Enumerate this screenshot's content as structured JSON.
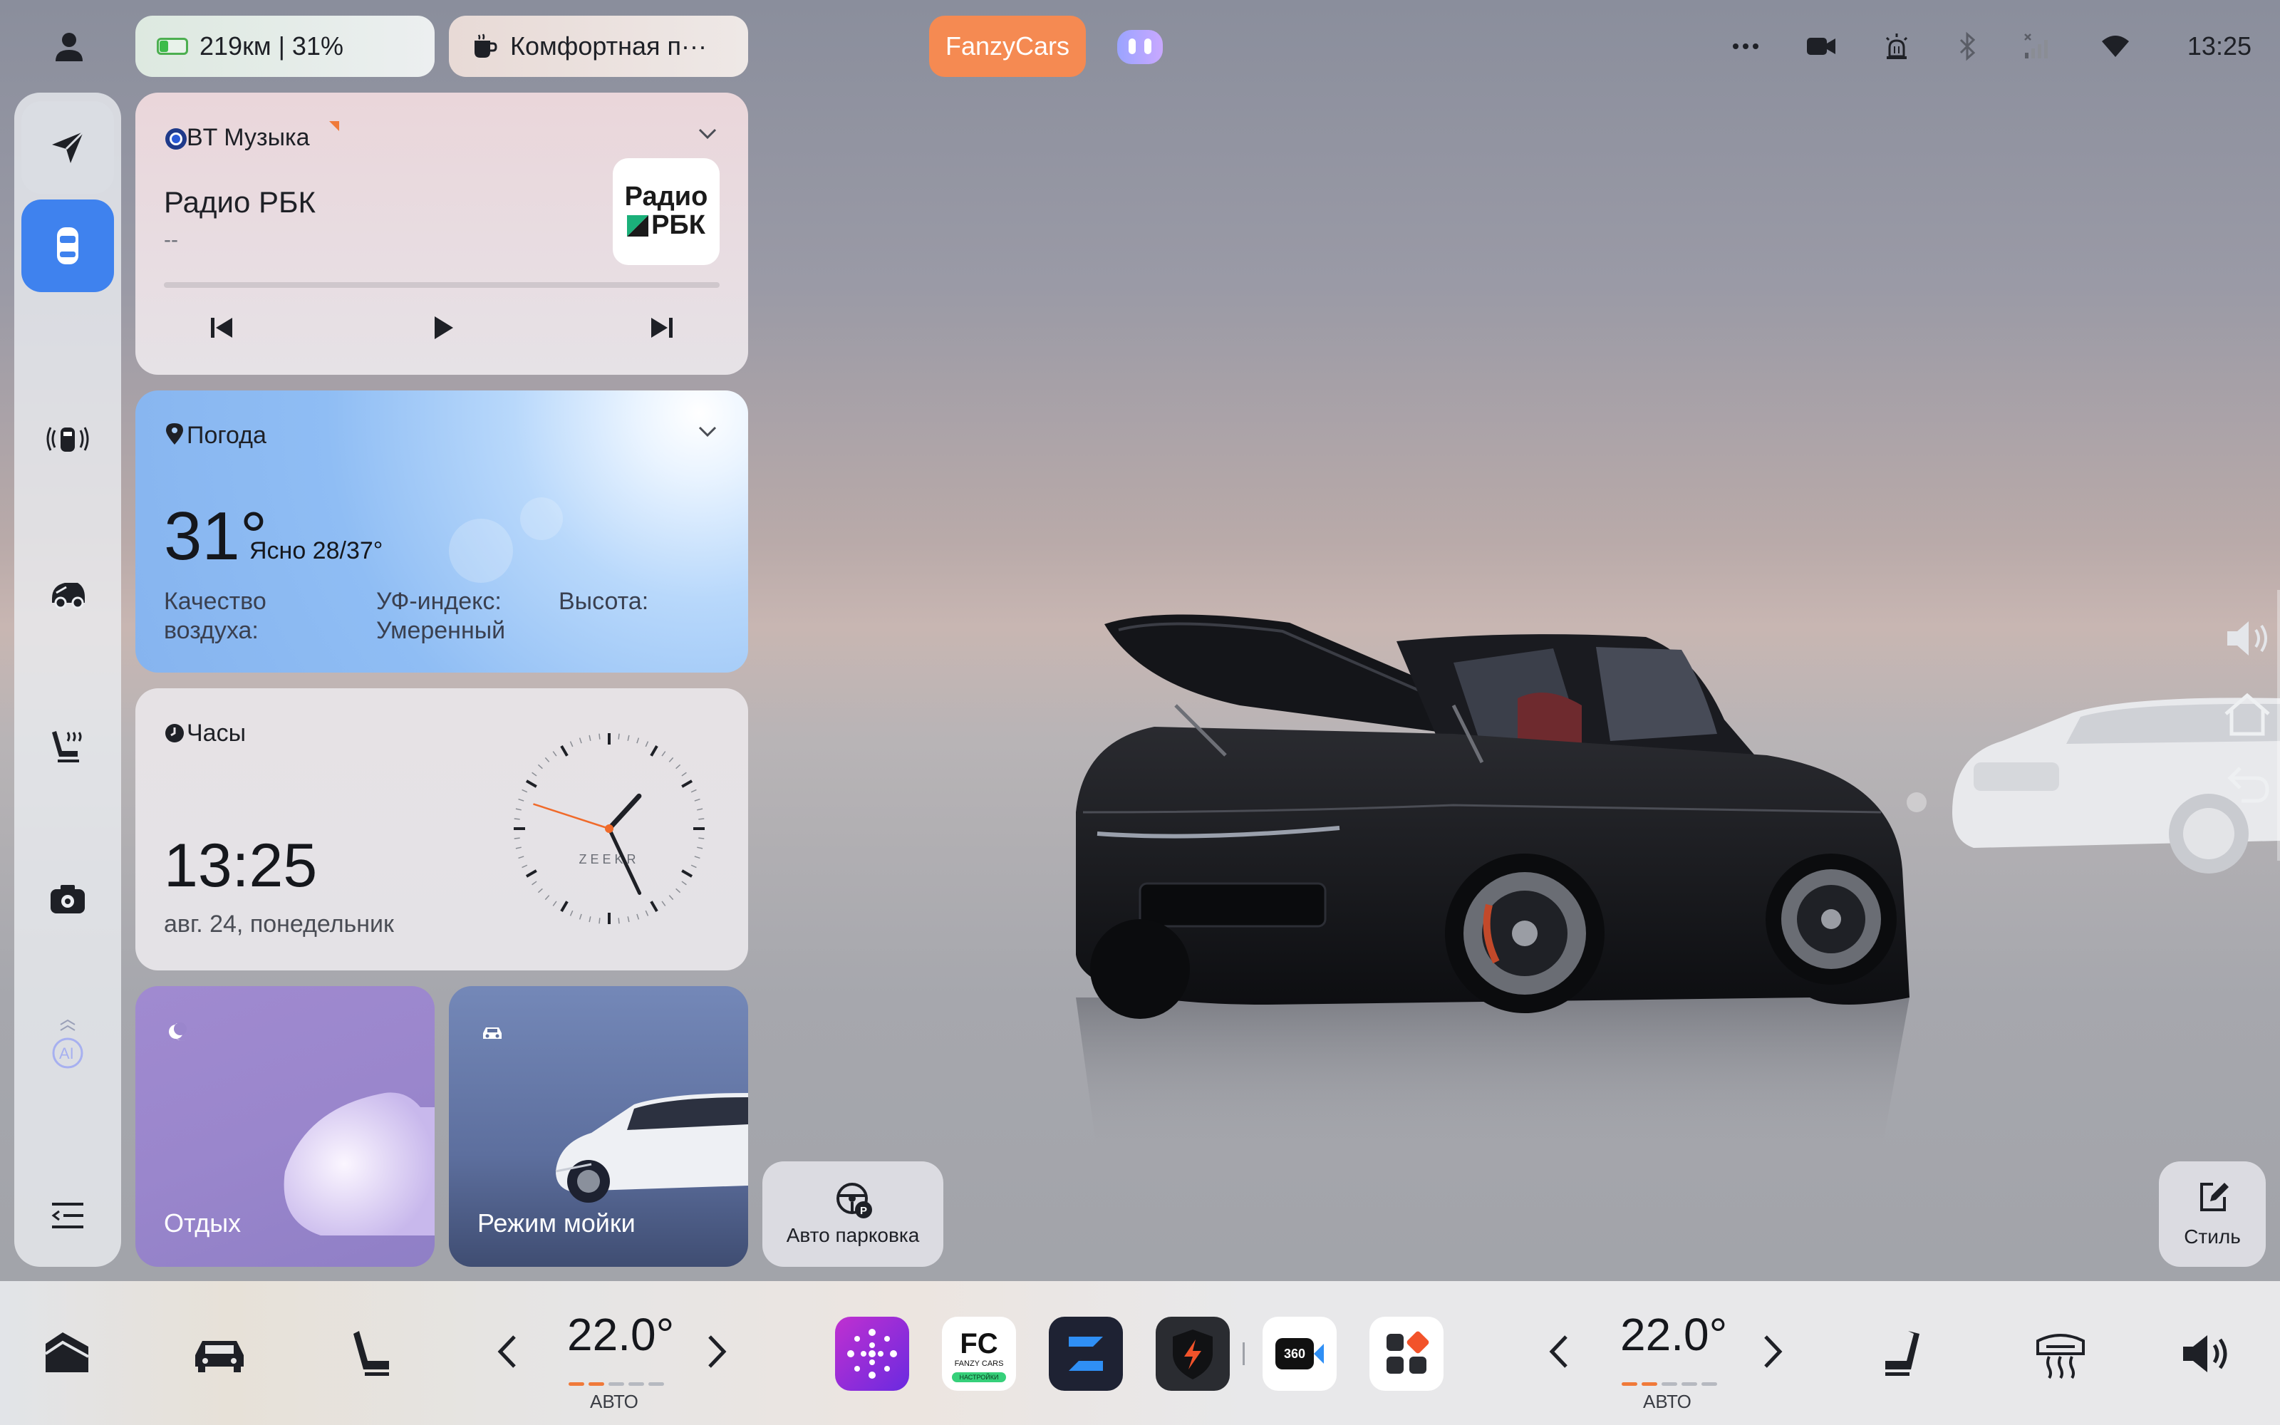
{
  "status_bar": {
    "range": "219км | 31%",
    "drive_mode": "Комфортная п···",
    "brand": "FanzyCars",
    "time": "13:25"
  },
  "music": {
    "source": "BT Музыка",
    "station": "Радио РБК",
    "subtitle": "--",
    "art_line1": "Радио",
    "art_line2": "РБК"
  },
  "weather": {
    "title": "Погода",
    "temperature": "31°",
    "description": "Ясно 28/37°",
    "air_quality": "Качество воздуха:",
    "uv": "УФ-индекс: Умеренный",
    "altitude": "Высота:"
  },
  "clock": {
    "title": "Часы",
    "time": "13:25",
    "date": "авг. 24, понедельник",
    "brand": "ZEEKR",
    "hour": 1,
    "minute": 25,
    "second": 48
  },
  "scenes": {
    "rest": "Отдых",
    "wash": "Режим мойки"
  },
  "auto_parking": "Авто парковка",
  "style": "Стиль",
  "climate": {
    "left_temp": "22.0°",
    "left_mode": "АВТО",
    "right_temp": "22.0°",
    "right_mode": "АВТО"
  },
  "apps": {
    "fc_top": "FC",
    "fc_mid": "FANZY CARS",
    "fc_bottom": "НАСТРОЙКИ",
    "cam360": "360"
  },
  "colors": {
    "accent_blue": "#3f82ee",
    "brand_orange": "#f58a52"
  }
}
